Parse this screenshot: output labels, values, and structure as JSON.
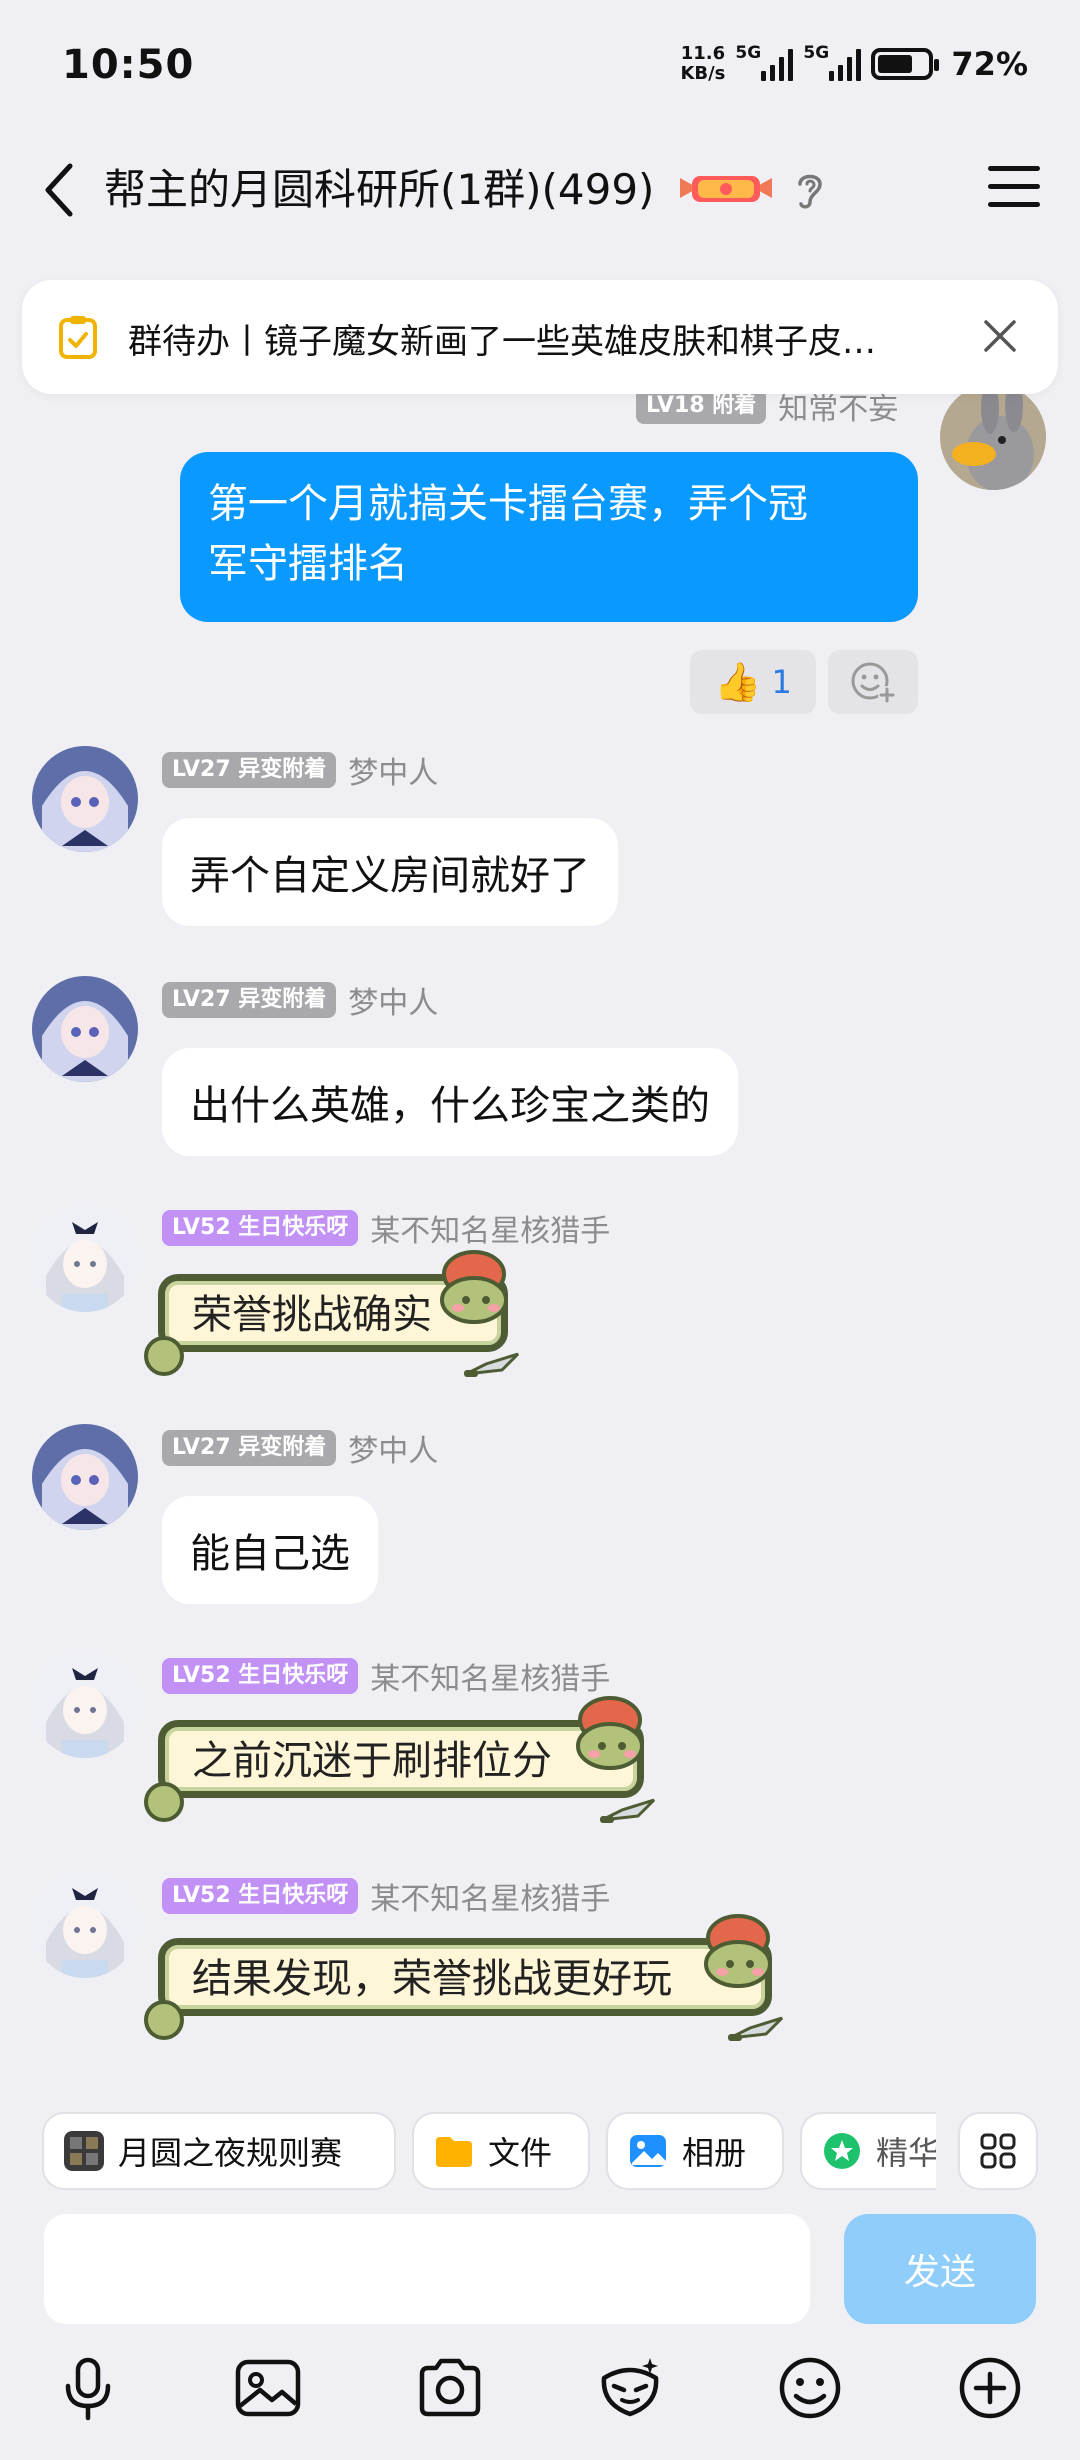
{
  "status_bar": {
    "time": "10:50",
    "net_speed_value": "11.6",
    "net_speed_unit": "KB/s",
    "signal1_label": "5G",
    "signal2_label": "5G",
    "battery": "72%"
  },
  "header": {
    "title": "帮主的月圆科研所(1群)(499)"
  },
  "todo": {
    "text": "群待办丨镜子魔女新画了一些英雄皮肤和棋子皮…"
  },
  "messages": [
    {
      "level": "LV18 附着",
      "nickname": "知常不妄",
      "text_line1": "第一个月就搞关卡擂台赛，弄个冠",
      "text_line2": "军守擂排名",
      "likes": "1"
    },
    {
      "level": "LV27 异变附着",
      "nickname": "梦中人",
      "text": "弄个自定义房间就好了"
    },
    {
      "level": "LV27 异变附着",
      "nickname": "梦中人",
      "text": "出什么英雄，什么珍宝之类的"
    },
    {
      "level": "LV52 生日快乐呀",
      "nickname": "某不知名星核猎手",
      "text": "荣誉挑战确实"
    },
    {
      "level": "LV27 异变附着",
      "nickname": "梦中人",
      "text": "能自己选"
    },
    {
      "level": "LV52 生日快乐呀",
      "nickname": "某不知名星核猎手",
      "text": "之前沉迷于刷排位分"
    },
    {
      "level": "LV52 生日快乐呀",
      "nickname": "某不知名星核猎手",
      "text": "结果发现，荣誉挑战更好玩"
    }
  ],
  "quick_actions": {
    "event": "月圆之夜规则赛",
    "files": "文件",
    "album": "相册",
    "featured": "精华"
  },
  "composer": {
    "placeholder": "",
    "send_label": "发送"
  },
  "colors": {
    "accent": "#0a99ff",
    "send_disabled": "#8fcdfb",
    "level_gray": "#a9a9ad",
    "level_purple": "#c291f5"
  }
}
